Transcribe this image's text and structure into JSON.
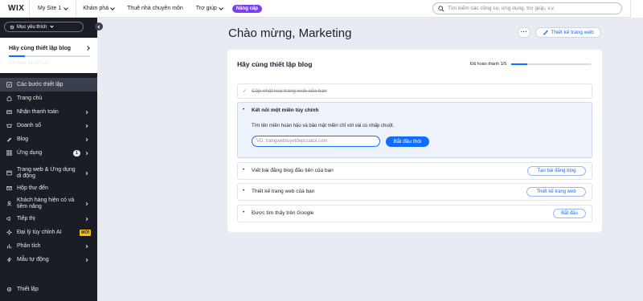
{
  "topbar": {
    "logo": "WIX",
    "site_name": "My Site 1",
    "nav": [
      {
        "label": "Khám phá",
        "has_dropdown": true
      },
      {
        "label": "Thuê nhà chuyên môn",
        "has_dropdown": false
      },
      {
        "label": "Trợ giúp",
        "has_dropdown": true
      }
    ],
    "upgrade_label": "Nâng cấp",
    "search_placeholder": "Tìm kiếm các công cụ, ứng dụng, trợ giúp, v.v."
  },
  "sidebar": {
    "feature_button": "Mục yêu thích",
    "setup_card": {
      "title": "Hãy cùng thiết lập blog",
      "progress_fraction": 0.2,
      "status": "Đã hoàn thành 1/5"
    },
    "items": [
      {
        "label": "Các bước thiết lập",
        "icon": "checklist-icon",
        "active": true,
        "chevron": false
      },
      {
        "label": "Trang chủ",
        "icon": "home-icon",
        "active": false,
        "chevron": false
      },
      {
        "label": "Nhận thanh toán",
        "icon": "payment-icon",
        "active": false,
        "chevron": true
      },
      {
        "label": "Doanh số",
        "icon": "sales-icon",
        "active": false,
        "chevron": true
      },
      {
        "label": "Blog",
        "icon": "blog-icon",
        "active": false,
        "chevron": true
      },
      {
        "label": "Ứng dụng",
        "icon": "apps-icon",
        "active": false,
        "chevron": true,
        "badge": "1"
      },
      {
        "label": "Trang web & Ứng dụng di động",
        "icon": "website-icon",
        "active": false,
        "chevron": true,
        "two_line": true,
        "gap_before": true
      },
      {
        "label": "Hộp thư đến",
        "icon": "inbox-icon",
        "active": false,
        "chevron": false
      },
      {
        "label": "Khách hàng hiện có và tiềm năng",
        "icon": "contacts-icon",
        "active": false,
        "chevron": true,
        "two_line": true
      },
      {
        "label": "Tiếp thị",
        "icon": "marketing-icon",
        "active": false,
        "chevron": true
      },
      {
        "label": "Đại lý tùy chỉnh AI",
        "icon": "ai-agent-icon",
        "active": false,
        "chevron": false,
        "new_badge": "MỚI"
      },
      {
        "label": "Phân tích",
        "icon": "analytics-icon",
        "active": false,
        "chevron": true
      },
      {
        "label": "Mẫu tự động",
        "icon": "automation-icon",
        "active": false,
        "chevron": true
      }
    ],
    "settings_label": "Thiết lập"
  },
  "main": {
    "greeting": "Chào mừng, Marketing",
    "more_label": "···",
    "design_button": "Thiết kế trang web",
    "panel": {
      "title": "Hãy cùng thiết lập blog",
      "progress_label": "Đã hoàn thành 1/5",
      "progress_fraction": 0.2,
      "steps": [
        {
          "label": "Cập nhật loại trang web của bạn",
          "state": "done"
        },
        {
          "label": "Kết nối một miền tùy chỉnh",
          "state": "open",
          "description": "Tìm tên miền hoàn hảo và bảo mật miền chỉ với vài cú nhấp chuột.",
          "input_placeholder": "VD: trangwebtuyetdepcuatoi.com",
          "action": "Bắt đầu thôi"
        },
        {
          "label": "Viết bài đăng blog đầu tiên của bạn",
          "state": "todo",
          "action": "Tạo bài đăng blog"
        },
        {
          "label": "Thiết kế trang web của bạn",
          "state": "todo",
          "action": "Thiết kế trang web"
        },
        {
          "label": "Được tìm thấy trên Google",
          "state": "todo",
          "action": "Bắt đầu"
        }
      ]
    }
  },
  "colors": {
    "accent": "#116dff",
    "upgrade": "#7a3ff2",
    "sidebar_bg": "#1a1d26",
    "page_bg": "#e8ebf1",
    "new_badge": "#ffbf00"
  }
}
